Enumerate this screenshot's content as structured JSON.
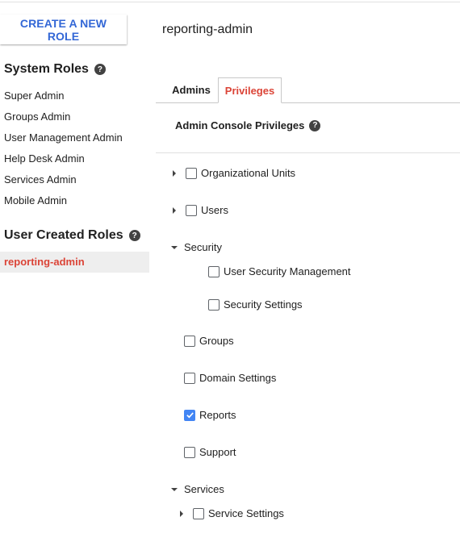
{
  "sidebar": {
    "create_button": "CREATE A NEW ROLE",
    "system_roles_title": "System Roles",
    "system_roles": [
      "Super Admin",
      "Groups Admin",
      "User Management Admin",
      "Help Desk Admin",
      "Services Admin",
      "Mobile Admin"
    ],
    "user_created_title": "User Created Roles",
    "user_created_roles": [
      "reporting-admin"
    ],
    "help_glyph": "?"
  },
  "main": {
    "role_name": "reporting-admin",
    "tabs": [
      {
        "label": "Admins",
        "active": false
      },
      {
        "label": "Privileges",
        "active": true
      }
    ],
    "privileges_title": "Admin Console Privileges",
    "tree": {
      "organizational_units": "Organizational Units",
      "users": "Users",
      "security": "Security",
      "user_security_management": "User Security Management",
      "security_settings": "Security Settings",
      "groups": "Groups",
      "domain_settings": "Domain Settings",
      "reports": "Reports",
      "support": "Support",
      "services": "Services",
      "service_settings": "Service Settings"
    },
    "checked": {
      "reports": true
    }
  },
  "colors": {
    "accent_blue": "#3367d6",
    "accent_red": "#db4437",
    "checkbox_blue": "#4285f4"
  }
}
